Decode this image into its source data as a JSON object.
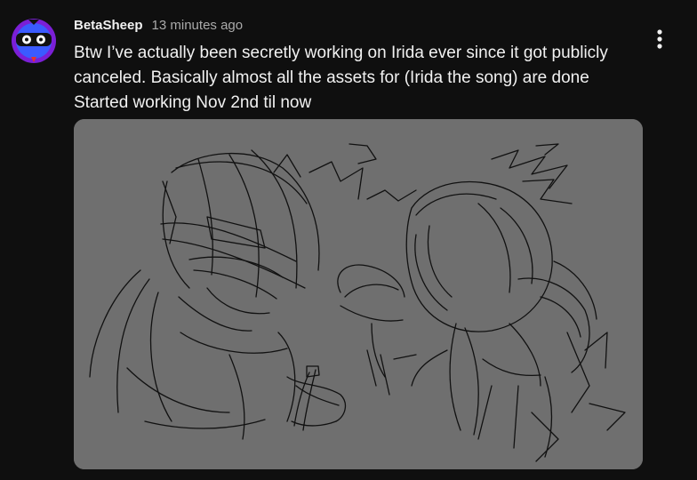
{
  "comment": {
    "author": "BetaSheep",
    "timestamp": "13 minutes ago",
    "text_lines": [
      "Btw I’ve actually been secretly working on Irida ever since it got publicly",
      "canceled. Basically almost all the assets for (Irida the song) are done",
      "Started working Nov 2nd til now"
    ],
    "avatar": {
      "icon": "masked-face-avatar",
      "colors": {
        "ring": "#7b1fd6",
        "face": "#3b5bff",
        "mask": "#111111",
        "eyes": "#ffffff",
        "accent": "#e8342b"
      }
    },
    "menu_icon": "vertical-ellipsis-icon",
    "attachment": {
      "type": "image",
      "description_icon": "sketch-image",
      "background": "#6f6f6f",
      "stroke": "#111111"
    }
  }
}
